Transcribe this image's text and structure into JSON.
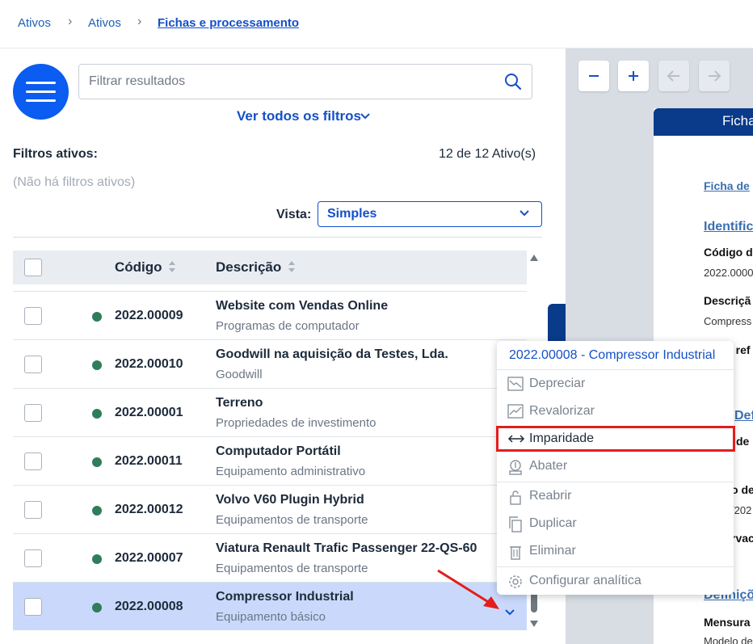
{
  "breadcrumb": {
    "items": [
      "Ativos",
      "Ativos"
    ],
    "current": "Fichas e processamento"
  },
  "search": {
    "placeholder": "Filtrar resultados"
  },
  "filters": {
    "link_label": "Ver todos os filtros",
    "active_label": "Filtros ativos:",
    "none_label": "(Não há filtros ativos)",
    "count_label": "12 de 12 Ativo(s)"
  },
  "view": {
    "label": "Vista:",
    "selected": "Simples"
  },
  "table": {
    "headers": {
      "code": "Código",
      "description": "Descrição"
    },
    "rows": [
      {
        "code": "2022.00009",
        "desc": "Website com Vendas Online",
        "category": "Programas de computador"
      },
      {
        "code": "2022.00010",
        "desc": "Goodwill na aquisição da Testes, Lda.",
        "category": "Goodwill"
      },
      {
        "code": "2022.00001",
        "desc": "Terreno",
        "category": "Propriedades de investimento"
      },
      {
        "code": "2022.00011",
        "desc": "Computador Portátil",
        "category": "Equipamento administrativo"
      },
      {
        "code": "2022.00012",
        "desc": "Volvo V60 Plugin Hybrid",
        "category": "Equipamentos de transporte"
      },
      {
        "code": "2022.00007",
        "desc": "Viatura Renault Trafic Passenger 22-QS-60",
        "category": "Equipamentos de transporte"
      },
      {
        "code": "2022.00008",
        "desc": "Compressor Industrial",
        "category": "Equipamento básico",
        "selected": true
      }
    ],
    "status_color": "#2f7d5b"
  },
  "context_menu": {
    "title": "2022.00008 - Compressor Industrial",
    "items": {
      "depreciar": "Depreciar",
      "revalorizar": "Revalorizar",
      "imparidade": "Imparidade",
      "abater": "Abater",
      "reabrir": "Reabrir",
      "duplicar": "Duplicar",
      "eliminar": "Eliminar",
      "configurar": "Configurar analítica"
    },
    "highlighted_item": "Imparidade",
    "highlight_color": "#e41d1d"
  },
  "preview": {
    "header": "Ficha",
    "lines": {
      "ficha_link": "Ficha de",
      "ident": "Identific",
      "codigo_lbl": "Código d",
      "codigo_val": "2022.0000",
      "descr_lbl": "Descriçã",
      "descr_val": "Compress",
      "ref_lbl": "a ref",
      "def1": "Definiçõ",
      "de_lbl": "de",
      "o_de": "o de",
      "date_val": "/202",
      "rvac": "rvac",
      "def2": "Definiçõ",
      "mensura": "Mensura",
      "modelo": "Modelo de"
    }
  },
  "colors": {
    "primary": "#0b5cf0",
    "link": "#1450c8",
    "selected_row": "#cad9fb"
  }
}
